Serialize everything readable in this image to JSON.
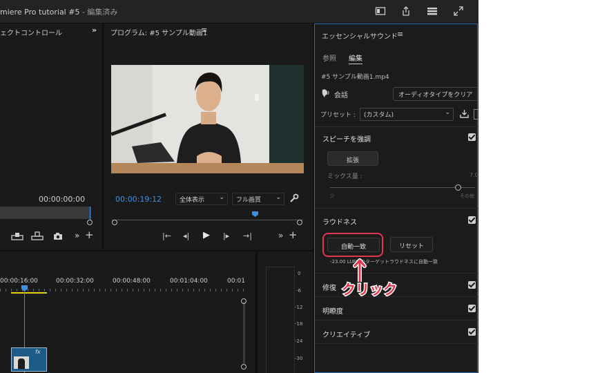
{
  "titlebar": {
    "title": "miere Pro tutorial #5",
    "suffix": " - 編集済み"
  },
  "effect_panel": {
    "title": "ェクトコントロール",
    "timecode": "00:00:00:00"
  },
  "program_panel": {
    "title": "プログラム: #5 サンプル動画1",
    "timecode": "00:00:19:12",
    "zoom_select": "全体表示",
    "quality_select": "フル画質"
  },
  "timeline": {
    "ruler_labels": [
      "00:00:16:00",
      "00:00:32:00",
      "00:00:48:00",
      "00:01:04:00",
      "00:01"
    ],
    "clip_fx": "fx"
  },
  "meter": {
    "labels": [
      "0",
      "-6",
      "-12",
      "-18",
      "-24",
      "-30"
    ]
  },
  "essential_sound": {
    "title": "エッセンシャルサウンド",
    "tabs": [
      "参照",
      "編集"
    ],
    "clip_name": "#5 サンプル動画1.mp4",
    "audio_type": "会話",
    "clear_button": "オーディオタイプをクリア",
    "preset_label": "プリセット :",
    "preset_value": "(カスタム)",
    "speech_section": "スピーチを強調",
    "enhance_button": "拡張",
    "mix_label": "ミックス量 :",
    "mix_value": "7.0",
    "mix_level": 0.88,
    "slider_min": "少",
    "slider_max": "その他",
    "loudness_section": "ラウドネス",
    "auto_match_button": "自動一致",
    "reset_button": "リセット",
    "loudness_note": "-23.00 LUFS のターゲットラウドネスに自動一致",
    "repair_section": "修復",
    "clarity_section": "明瞭度",
    "creative_section": "クリエイティブ"
  },
  "annotation": {
    "label": "クリック",
    "color": "#e4354e"
  }
}
